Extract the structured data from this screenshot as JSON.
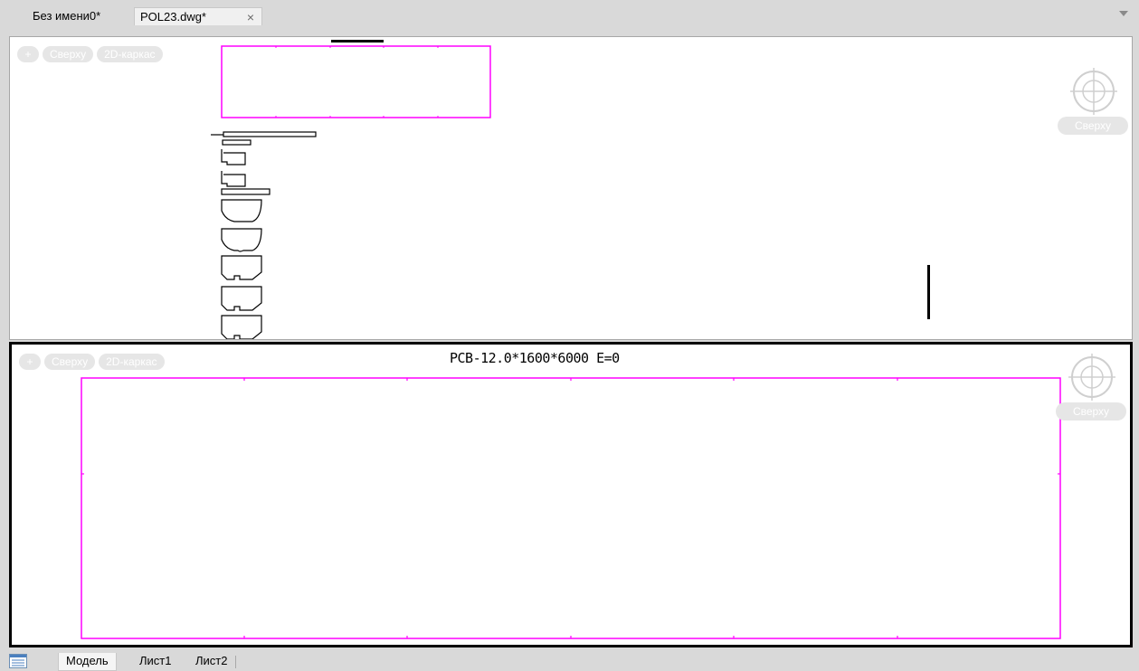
{
  "tabs": [
    {
      "label": "Без имени0*"
    },
    {
      "label": "POL23.dwg*",
      "close": "×"
    }
  ],
  "viewport_top": {
    "controls": {
      "plus": "+",
      "view": "Сверху",
      "style": "2D-каркас"
    },
    "viewcube_label": "Сверху"
  },
  "viewport_bottom": {
    "controls": {
      "plus": "+",
      "view": "Сверху",
      "style": "2D-каркас"
    },
    "viewcube_label": "Сверху",
    "caption": "PCB-12.0*1600*6000  E=0"
  },
  "sheet_tabs": [
    {
      "label": "Модель"
    },
    {
      "label": "Лист1"
    },
    {
      "label": "Лист2"
    }
  ],
  "colors": {
    "drawing_outline": "#ff00ff",
    "background": "#d9d9d9",
    "active_border": "#000000"
  }
}
